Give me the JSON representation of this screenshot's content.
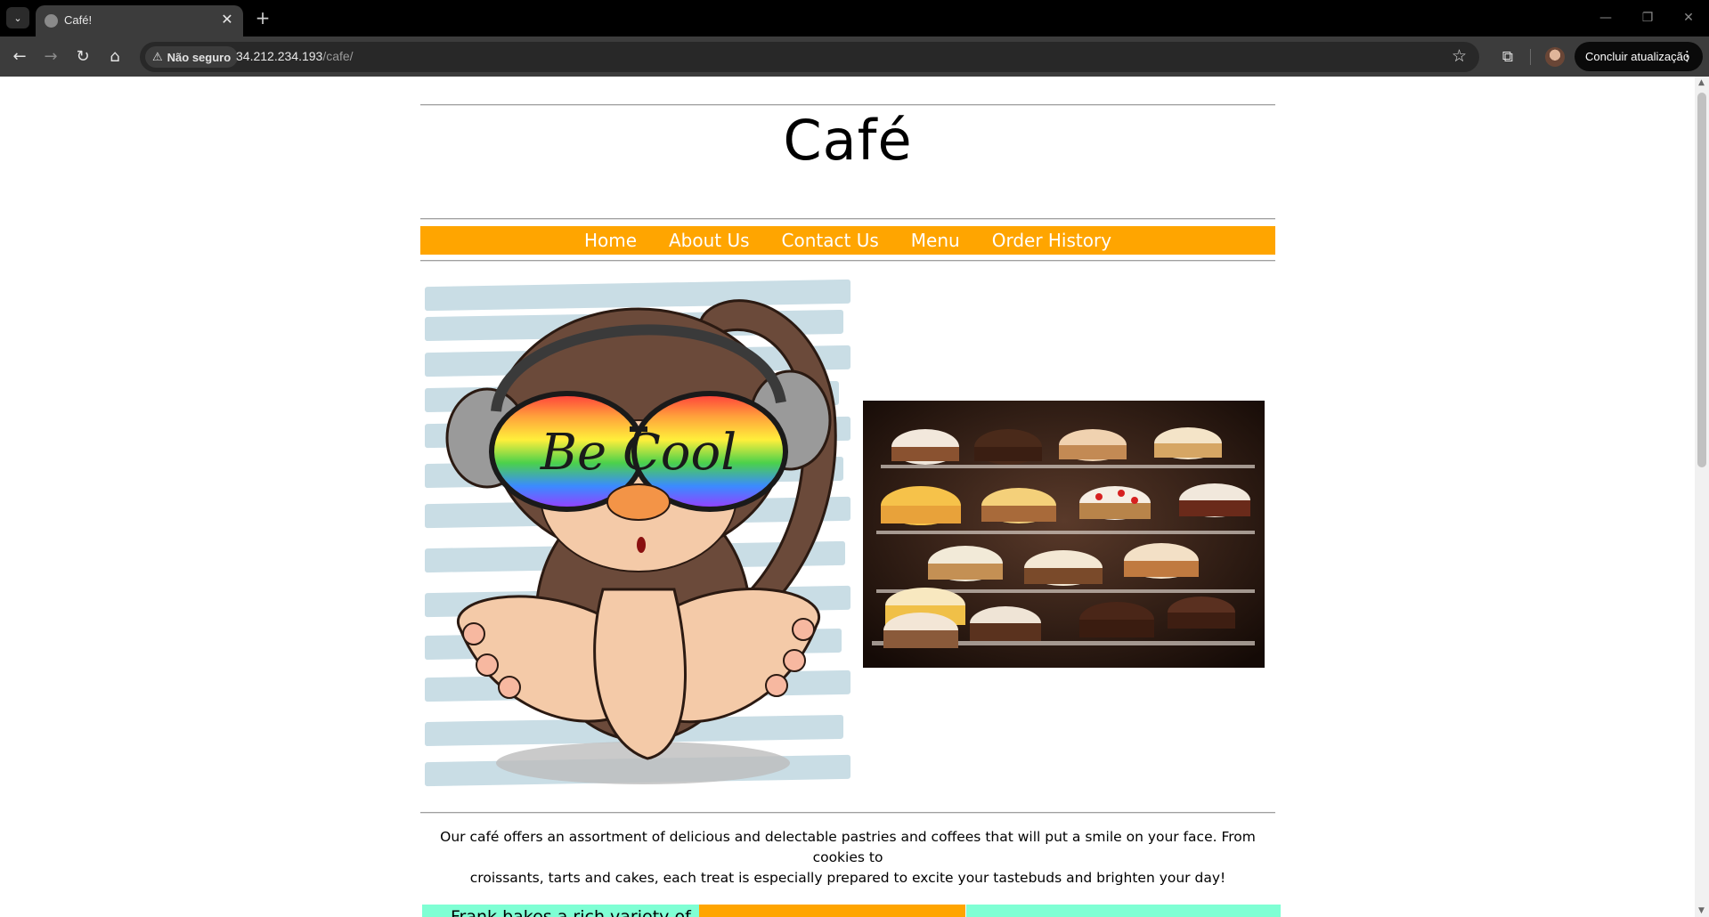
{
  "browser": {
    "tab_title": "Café!",
    "new_tab_glyph": "+",
    "security_label": "Não seguro",
    "url_host": "34.212.234.193",
    "url_path": "/cafe/",
    "update_button": "Concluir atualização"
  },
  "site": {
    "title": "Café",
    "nav": [
      "Home",
      "About Us",
      "Contact Us",
      "Menu",
      "Order History"
    ],
    "hero_image_text": "Be Cool",
    "description_line1": "Our café offers an assortment of delicious and delectable pastries and coffees that will put a smile on your face. From cookies to",
    "description_line2": "croissants, tarts and cakes, each treat is especially prepared to excite your tastebuds and brighten your day!",
    "promo_text_1": "Frank bakes a rich variety of"
  },
  "colors": {
    "nav_background": "#ffa500",
    "promo_mint": "#7fffd4",
    "promo_orange": "#ffa500",
    "browser_bar": "#3c3c3c"
  },
  "icons": {
    "tab_menu": "chevron-down-icon",
    "back": "arrow-left-icon",
    "forward": "arrow-right-icon",
    "reload": "reload-icon",
    "home": "home-icon",
    "warning": "warning-icon",
    "bookmark": "star-icon",
    "extensions": "puzzle-icon",
    "menu": "kebab-icon"
  }
}
